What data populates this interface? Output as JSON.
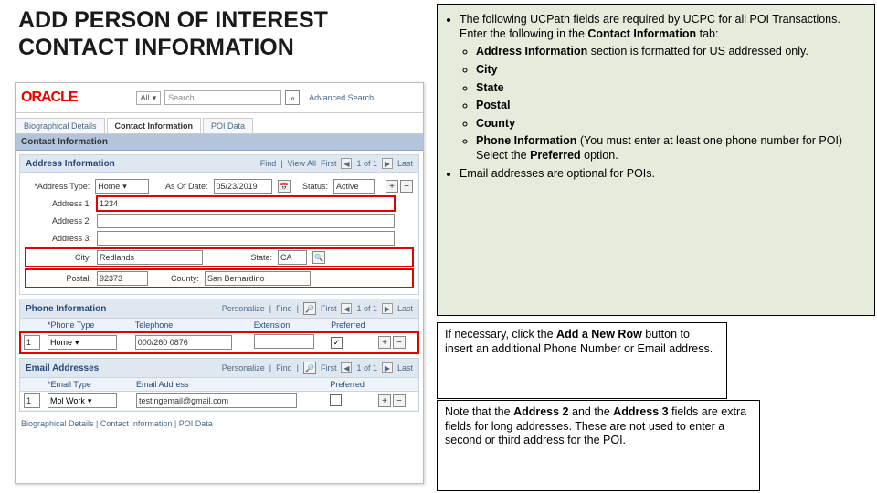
{
  "title": "ADD PERSON OF INTEREST CONTACT INFORMATION",
  "oracle": {
    "logo": "ORACLE",
    "all": "All",
    "search_ph": "Search",
    "go": "»",
    "adv": "Advanced Search"
  },
  "tabs": {
    "bio": "Biographical Details",
    "contact": "Contact Information",
    "poi": "POI Data"
  },
  "section": "Contact Information",
  "addr": {
    "hdr": "Address Information",
    "find": "Find",
    "view": "View All",
    "first": "First",
    "count": "1 of 1",
    "last": "Last",
    "addrtype_lbl": "*Address Type:",
    "addrtype_val": "Home",
    "asof_lbl": "As Of Date:",
    "asof_val": "05/23/2019",
    "status_lbl": "Status:",
    "status_val": "Active",
    "a1_lbl": "Address 1:",
    "a1_val": "1234",
    "a2_lbl": "Address 2:",
    "a3_lbl": "Address 3:",
    "city_lbl": "City:",
    "city_val": "Redlands",
    "state_lbl": "State:",
    "state_val": "CA",
    "postal_lbl": "Postal:",
    "postal_val": "92373",
    "county_lbl": "County:",
    "county_val": "San Bernardino"
  },
  "phone": {
    "hdr": "Phone Information",
    "pers": "Personalize",
    "find": "Find",
    "first": "First",
    "count": "1 of 1",
    "last": "Last",
    "th_type": "*Phone Type",
    "th_tel": "Telephone",
    "th_ext": "Extension",
    "th_pref": "Preferred",
    "seq": "1",
    "type_val": "Home",
    "tel_val": "000/260 0876",
    "pref_checked": "✓"
  },
  "email": {
    "hdr": "Email Addresses",
    "pers": "Personalize",
    "find": "Find",
    "first": "First",
    "count": "1 of 1",
    "last": "Last",
    "th_type": "*Email Type",
    "th_addr": "Email Address",
    "th_pref": "Preferred",
    "seq": "1",
    "type_val": "Mol Work",
    "val": "testingemail@gmail.com"
  },
  "footer": "Biographical Details | Contact Information | POI Data",
  "instr": {
    "p1a": "The following UCPath fields are required by UCPC for all POI Transactions. Enter the following in the ",
    "p1b": "Contact Information",
    "p1c": " tab:",
    "s1a": "Address Information",
    "s1b": " section is formatted for US addressed only.",
    "s2": "City",
    "s3": "State",
    "s4": "Postal",
    "s5": "County",
    "s6a": "Phone Information",
    "s6b": " (You must enter at least one phone number for POI) Select the ",
    "s6c": "Preferred",
    "s6d": " option.",
    "p2": "Email addresses are optional for POIs."
  },
  "note1": {
    "a": "If necessary, click the ",
    "b": "Add a New Row",
    "c": " button to insert an additional Phone Number or Email address."
  },
  "note2": {
    "a": "Note that the ",
    "b": "Address 2",
    "c": " and the ",
    "d": "Address 3",
    "e": " fields are extra fields for long addresses. These are not used to enter a second or third address for the POI."
  }
}
